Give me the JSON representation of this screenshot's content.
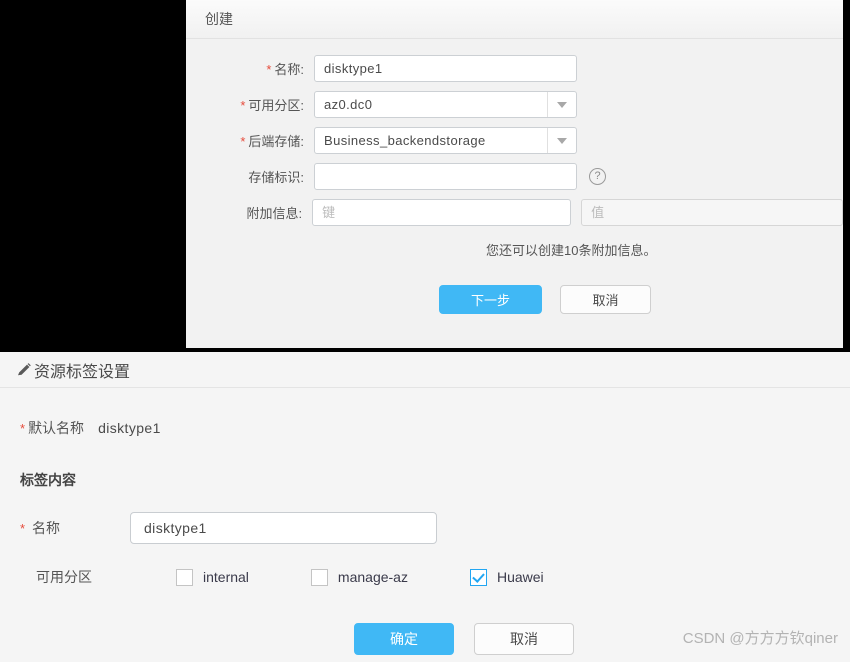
{
  "create_dialog": {
    "title": "创建",
    "fields": {
      "name": {
        "label": "名称:",
        "required_mark": "*",
        "value": "disktype1"
      },
      "availability_zone": {
        "label": "可用分区:",
        "required_mark": "*",
        "value": "az0.dc0"
      },
      "backend_storage": {
        "label": "后端存储:",
        "required_mark": "*",
        "value": "Business_backendstorage"
      },
      "storage_id": {
        "label": "存储标识:",
        "value": "",
        "placeholder": "",
        "help_icon": "question-mark-icon"
      },
      "extra_info": {
        "label": "附加信息:",
        "key_placeholder": "键",
        "key_value": "",
        "value_placeholder": "值",
        "value_value": ""
      }
    },
    "hint": "您还可以创建10条附加信息。",
    "buttons": {
      "next": "下一步",
      "cancel": "取消"
    }
  },
  "tag_panel": {
    "icon": "pencil-icon",
    "title": "资源标签设置",
    "default_name": {
      "required_mark": "*",
      "label": "默认名称",
      "value": "disktype1"
    },
    "section_heading": "标签内容",
    "name_field": {
      "required_mark": "*",
      "label": "名称",
      "value": "disktype1"
    },
    "availability_zone": {
      "label": "可用分区",
      "options": [
        {
          "label": "internal",
          "checked": false
        },
        {
          "label": "manage-az",
          "checked": false
        },
        {
          "label": "Huawei",
          "checked": true
        }
      ]
    },
    "buttons": {
      "ok": "确定",
      "cancel": "取消"
    }
  },
  "watermark": "CSDN @方方方钦qiner",
  "colors": {
    "primary_blue": "#40b8f5",
    "checkbox_blue": "#22a6f2",
    "required_red": "#e64b3b"
  }
}
